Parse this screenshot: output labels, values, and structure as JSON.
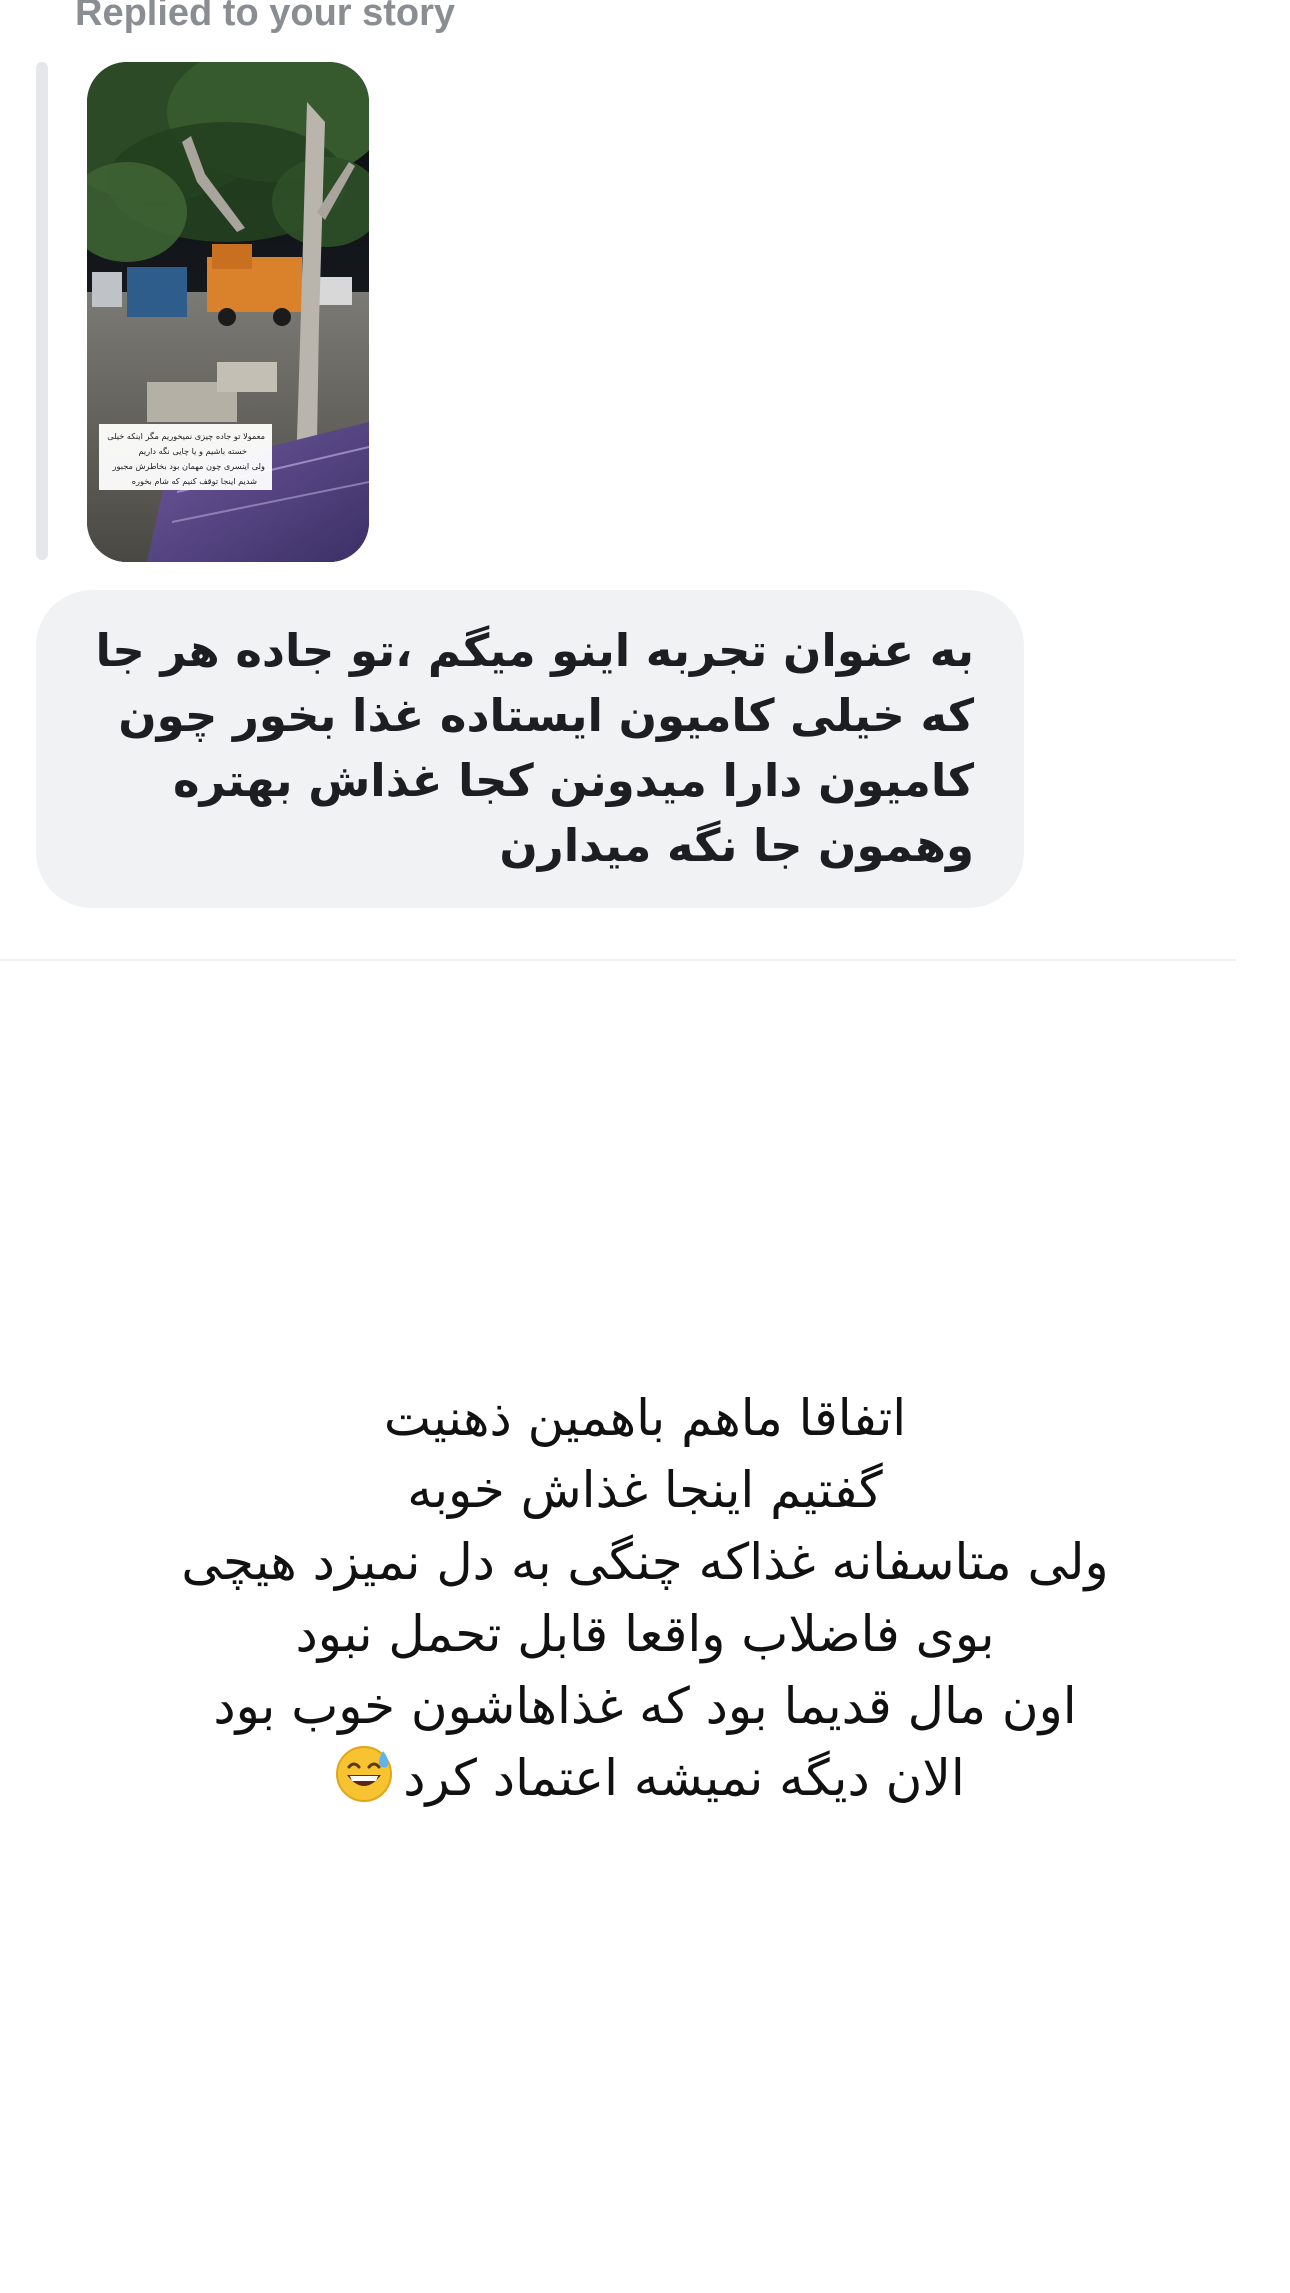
{
  "reply_label": "Replied to your story",
  "story_preview": {
    "caption_lines": [
      "معمولا تو جاده چیزی نمیخوریم مگر اینکه خیلی",
      "خسته باشیم و یا چایی نگه داریم",
      "ولی اینسری چون مهمان بود بخاطرش مجبور",
      "شدیم اینجا توقف کنیم که شام بخوره"
    ]
  },
  "message": {
    "text": "به عنوان تجربه اینو میگم ،تو جاده هر جا که خیلی کامیون ایستاده غذا بخور چون کامیون دارا میدونن کجا غذاش بهتره وهمون جا نگه میدارن"
  },
  "story_text": {
    "lines": [
      "اتفاقا ماهم باهمین ذهنیت",
      "گفتیم اینجا غذاش خوبه",
      "ولی متاسفانه غذاکه چنگی به دل نمیزد هیچی",
      "بوی فاضلاب واقعا قابل تحمل نبود",
      "اون مال قدیما بود که غذاهاشون خوب بود",
      "الان دیگه نمیشه اعتماد کرد"
    ],
    "emoji_icon": "grinning-face-with-sweat-icon"
  }
}
